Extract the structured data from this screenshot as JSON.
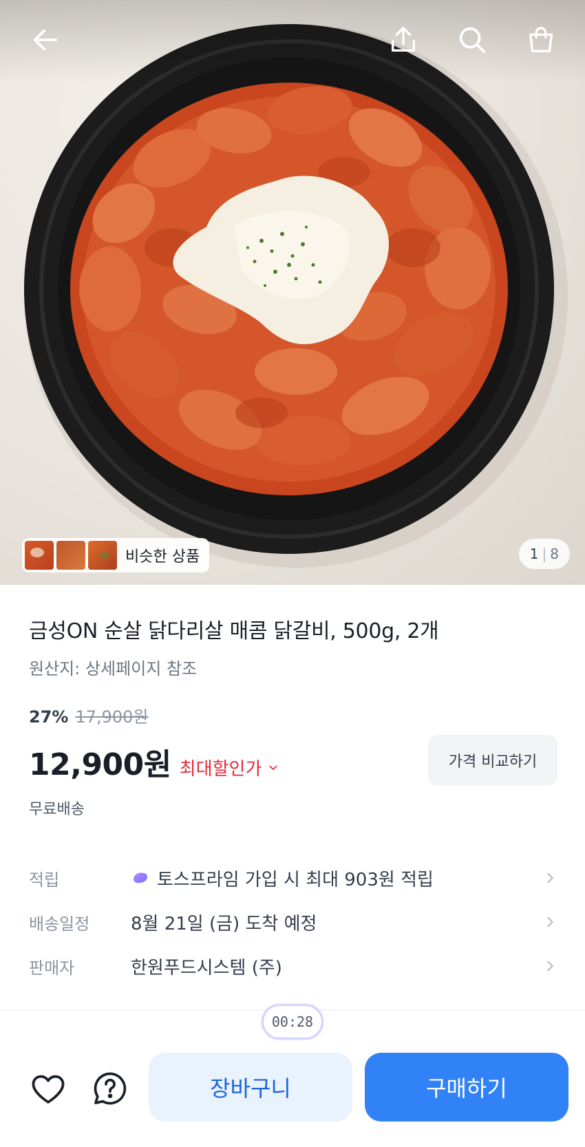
{
  "gallery": {
    "similar_label": "비슷한 상품",
    "current_index": "1",
    "total_count": "8",
    "separator": "|"
  },
  "topbar": {
    "icons": [
      "back-arrow-icon",
      "share-icon",
      "search-icon",
      "shopping-bag-icon"
    ]
  },
  "product": {
    "title": "금성ON 순살 닭다리살 매콤 닭갈비, 500g, 2개",
    "origin": "원산지: 상세페이지 참조",
    "discount_percent": "27%",
    "original_price": "17,900원",
    "sale_price": "12,900원",
    "max_discount_label": "최대할인가",
    "compare_label": "가격 비교하기",
    "shipping": "무료배송"
  },
  "details": [
    {
      "label": "적립",
      "value": "토스프라임 가입 시 최대 903원 적립"
    },
    {
      "label": "배송일정",
      "value": "8월 21일 (금) 도착 예정"
    },
    {
      "label": "판매자",
      "value": "한원푸드시스템 (주)"
    }
  ],
  "bottom_bar": {
    "timer": "00:28",
    "cart_label": "장바구니",
    "buy_label": "구매하기"
  },
  "colors": {
    "accent_blue": "#3182f6",
    "light_blue": "#e8f3ff",
    "discount_red": "#e42939",
    "text_primary": "#191f28",
    "text_secondary": "#6b7684"
  }
}
